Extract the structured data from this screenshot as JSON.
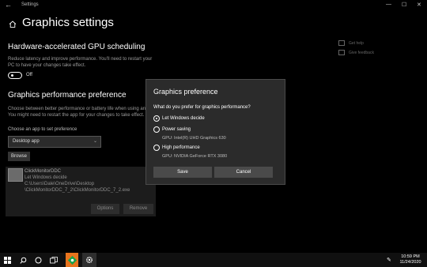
{
  "window": {
    "title": "Settings",
    "back_glyph": "←",
    "minimize_glyph": "—",
    "maximize_glyph": "☐",
    "close_glyph": "✕"
  },
  "page": {
    "title": "Graphics settings"
  },
  "gpu_scheduling": {
    "heading": "Hardware-accelerated GPU scheduling",
    "desc_line1": "Reduce latency and improve performance. You'll need to restart your",
    "desc_line2": "PC to have your changes take effect.",
    "toggle_state": "Off"
  },
  "graphics_pref": {
    "heading": "Graphics performance preference",
    "desc_line1": "Choose between better performance or battery life when using an",
    "desc_line2": "You might need to restart the app for your changes to take effect.",
    "select_label": "Choose an app to set preference",
    "select_value": "Desktop app",
    "browse_label": "Browse"
  },
  "app_entry": {
    "name": "ClickMonitorDDC",
    "pref": "Let Windows decide",
    "path_line1": "C:\\Users\\Dale\\OneDrive\\Desktop",
    "path_line2": "\\ClickMonitorDDC_7_2\\ClickMonitorDDC_7_2.exe",
    "options_label": "Options",
    "remove_label": "Remove"
  },
  "side_links": {
    "help": "Get help",
    "feedback": "Give feedback"
  },
  "dialog": {
    "title": "Graphics preference",
    "question": "What do you prefer for graphics performance?",
    "option1": "Let Windows decide",
    "option2": "Power saving",
    "option2_gpu": "GPU: Intel(R) UHD Graphics 630",
    "option3": "High performance",
    "option3_gpu": "GPU: NVIDIA GeForce RTX 3080",
    "save_label": "Save",
    "cancel_label": "Cancel",
    "selected": "Let Windows decide"
  },
  "taskbar": {
    "time": "10:59 PM",
    "date": "11/24/2020",
    "start_icon": "windows-start-icon",
    "search_icon": "search-icon",
    "taskview_icon": "task-view-icon",
    "highlight_color": "#e8741d"
  }
}
